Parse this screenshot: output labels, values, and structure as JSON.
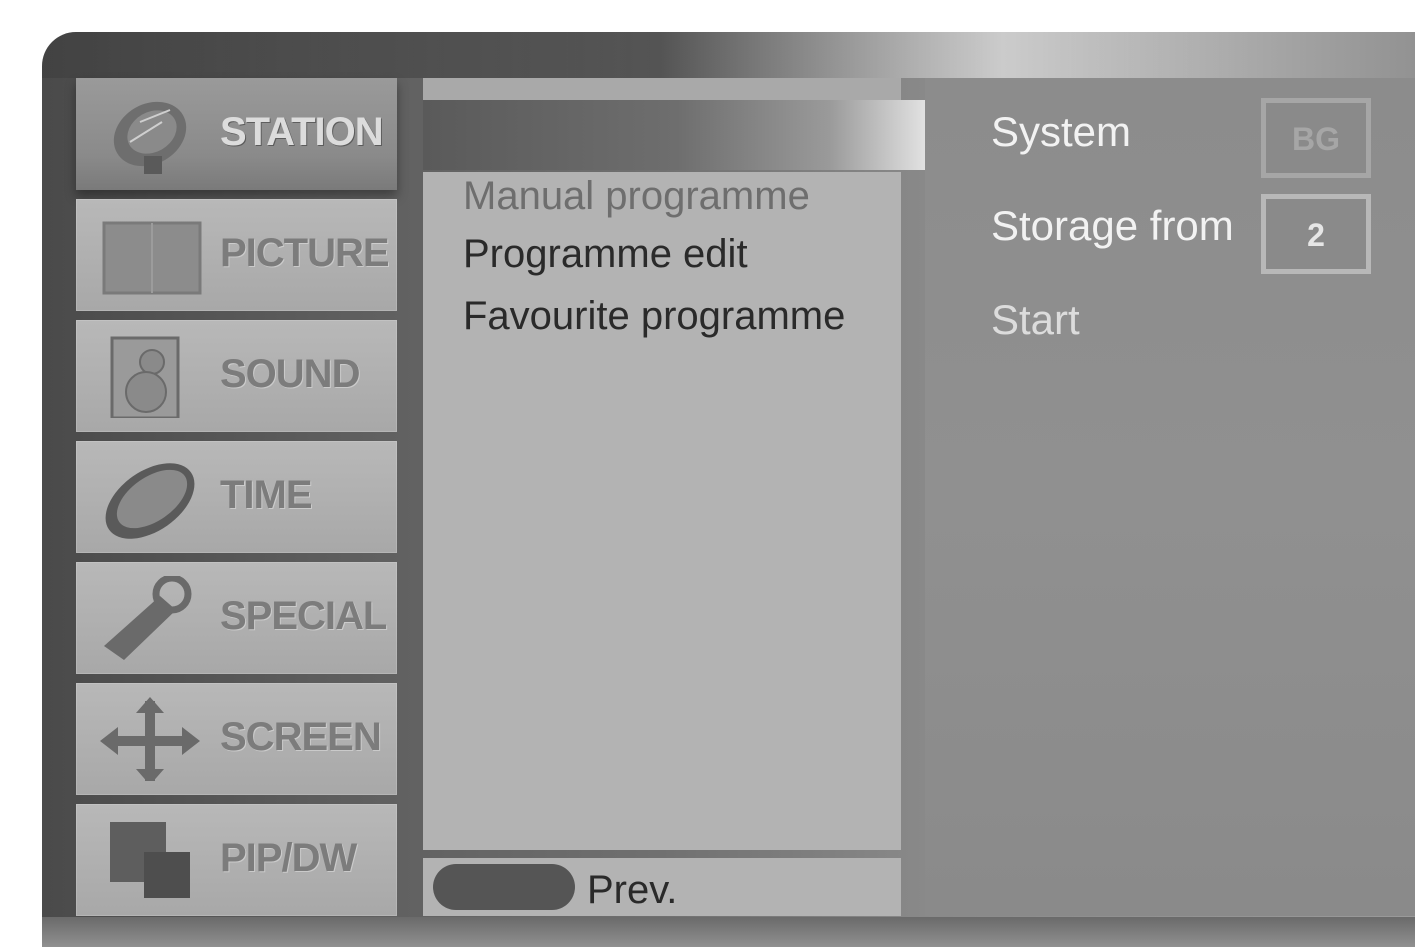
{
  "left_menu": {
    "items": [
      {
        "label": "STATION",
        "icon": "satellite-dish-icon",
        "active": true
      },
      {
        "label": "PICTURE",
        "icon": "picture-frame-icon",
        "active": false
      },
      {
        "label": "SOUND",
        "icon": "speaker-icon",
        "active": false
      },
      {
        "label": "TIME",
        "icon": "clock-oval-icon",
        "active": false
      },
      {
        "label": "SPECIAL",
        "icon": "key-tag-icon",
        "active": false
      },
      {
        "label": "SCREEN",
        "icon": "four-arrows-icon",
        "active": false
      },
      {
        "label": "PIP/DW",
        "icon": "pip-windows-icon",
        "active": false
      }
    ]
  },
  "submenu": {
    "items": [
      {
        "label": "Manual programme",
        "faded": true
      },
      {
        "label": "Programme edit",
        "faded": false
      },
      {
        "label": "Favourite programme",
        "faded": false
      }
    ],
    "prev_label": "Prev."
  },
  "settings": {
    "system_label": "System",
    "system_value": "BG",
    "storage_label": "Storage from",
    "storage_value": "2",
    "start_label": "Start"
  }
}
